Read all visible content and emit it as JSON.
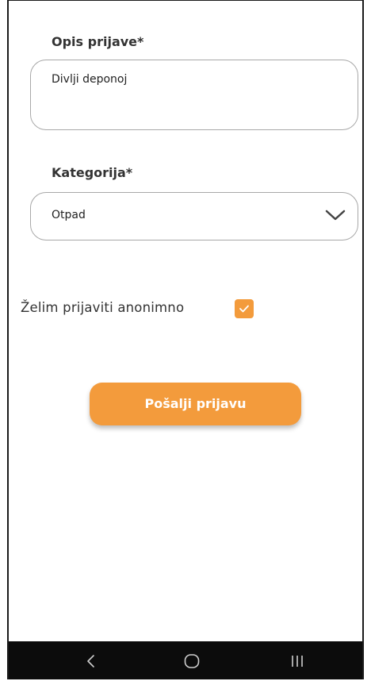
{
  "form": {
    "description_label": "Opis prijave*",
    "description_value": "Divlji deponoj",
    "category_label": "Kategorija*",
    "category_value": "Otpad",
    "anonymous_label": "Želim prijaviti anonimno",
    "anonymous_checked": true,
    "submit_label": "Pošalji prijavu"
  },
  "nav": {
    "back_icon": "back-chevron",
    "home_icon": "home-circle",
    "recent_icon": "recent-apps"
  },
  "colors": {
    "accent": "#f39b3c",
    "text": "#333333",
    "border": "#a8a8a8",
    "navbar": "#0c0c0c"
  }
}
